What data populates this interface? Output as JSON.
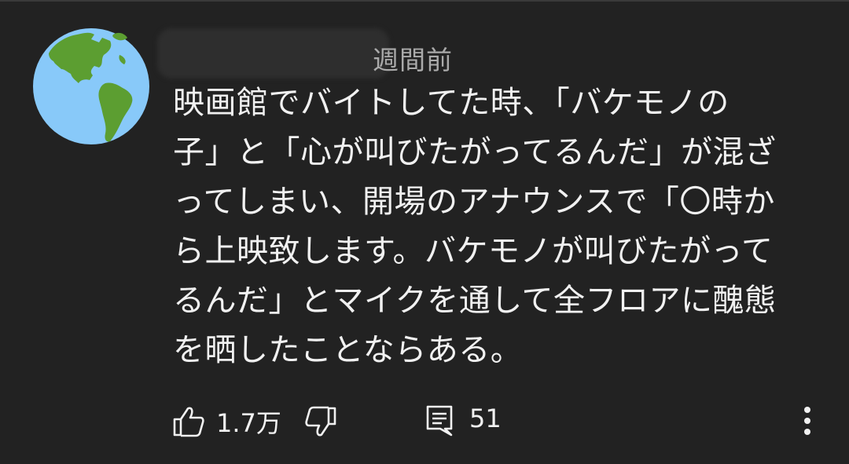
{
  "comment": {
    "author_name": "",
    "time_ago": "週間前",
    "lines": [
      "映画館でバイトしてた時、「バケモノの",
      "子」と「心が叫びたがってるんだ」が混ざ",
      "ってしまい、開場のアナウンスで「〇時か",
      "ら上映致します。バケモノが叫びたがって",
      "るんだ」とマイクを通して全フロアに醜態",
      "を晒したことならある。"
    ]
  },
  "actions": {
    "like_count": "1.7万",
    "reply_count": "51"
  },
  "icons": {
    "avatar": "globe-americas-icon",
    "like": "thumbs-up-icon",
    "dislike": "thumbs-down-icon",
    "reply": "reply-comment-icon",
    "more": "more-vertical-icon"
  },
  "colors": {
    "background": "#222222",
    "text": "#f1f1f1",
    "secondary_text": "#aaaaaa",
    "globe_ocean": "#88c9f9",
    "globe_land": "#5c9e31"
  }
}
